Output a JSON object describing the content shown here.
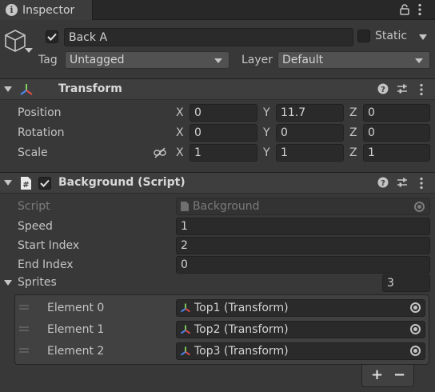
{
  "window": {
    "tab_label": "Inspector"
  },
  "object": {
    "enabled": true,
    "name": "Back A",
    "static_label": "Static",
    "static_checked": false,
    "tag_label": "Tag",
    "tag_value": "Untagged",
    "layer_label": "Layer",
    "layer_value": "Default"
  },
  "transform": {
    "title": "Transform",
    "rows": [
      {
        "label": "Position",
        "x": "0",
        "y": "11.7",
        "z": "0"
      },
      {
        "label": "Rotation",
        "x": "0",
        "y": "0",
        "z": "0"
      },
      {
        "label": "Scale",
        "x": "1",
        "y": "1",
        "z": "1"
      }
    ],
    "axes": {
      "x": "X",
      "y": "Y",
      "z": "Z"
    }
  },
  "script": {
    "title": "Background (Script)",
    "enabled": true,
    "script_label": "Script",
    "script_value": "Background",
    "fields": [
      {
        "label": "Speed",
        "value": "1"
      },
      {
        "label": "Start Index",
        "value": "2"
      },
      {
        "label": "End Index",
        "value": "0"
      }
    ],
    "sprites_label": "Sprites",
    "sprites_count": "3",
    "elements": [
      {
        "label": "Element 0",
        "value": "Top1 (Transform)"
      },
      {
        "label": "Element 1",
        "value": "Top2 (Transform)"
      },
      {
        "label": "Element 2",
        "value": "Top3 (Transform)"
      }
    ],
    "add_label": "+",
    "remove_label": "−"
  },
  "colors": {
    "background": "#383838",
    "field": "#2a2a2a",
    "header": "#3e3e3e",
    "text": "#c4c4c4"
  }
}
